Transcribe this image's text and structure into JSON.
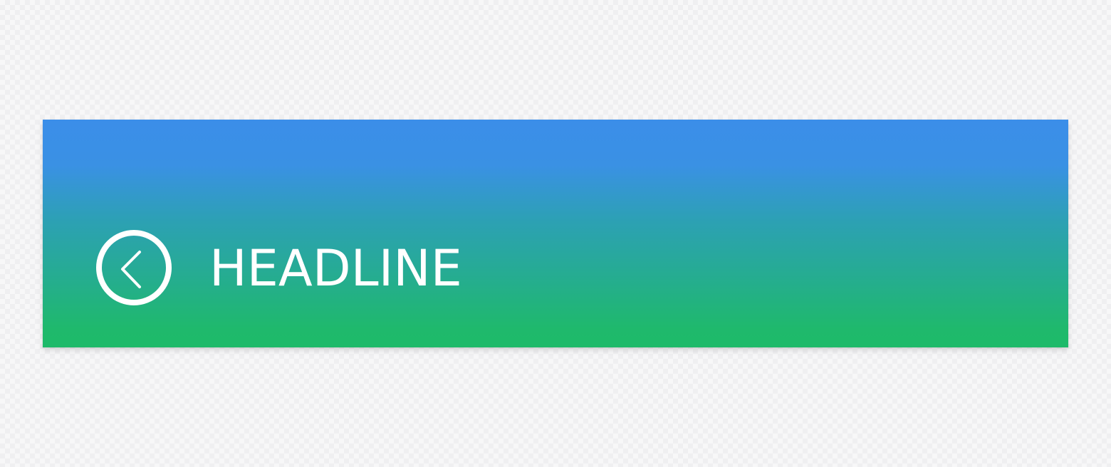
{
  "header": {
    "title": "HEADLINE",
    "back_icon": "chevron-left-circle-icon",
    "gradient_top_color": "#3b8ee9",
    "gradient_bottom_color": "#1eba69",
    "text_color": "#ffffff"
  }
}
